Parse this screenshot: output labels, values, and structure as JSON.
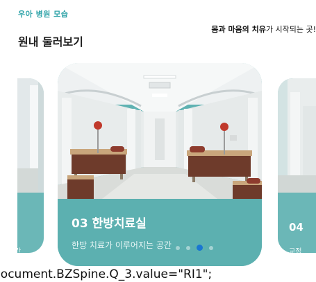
{
  "header": {
    "eyebrow": "우아 병원 모습",
    "title": "원내 둘러보기",
    "tagline_strong": "몸과 마음의 치유",
    "tagline_rest": "가 시작되는 곳!"
  },
  "slider": {
    "active_slide": {
      "title": "03 한방치료실",
      "subtitle": "한방 치료가 이루어지는 공간"
    },
    "prev_slide": {
      "subtitle_fragment": "간"
    },
    "next_slide": {
      "number": "04",
      "subtitle_fragment": "교정"
    },
    "dots": {
      "count": 4,
      "active_index": 2
    }
  },
  "page_artifact": {
    "text": "document.BZSpine.Q_3.value=\"RI1\";"
  },
  "colors": {
    "accent": "#2ea3a8",
    "band": "#5cb0b0",
    "active_dot": "#1976d2"
  }
}
